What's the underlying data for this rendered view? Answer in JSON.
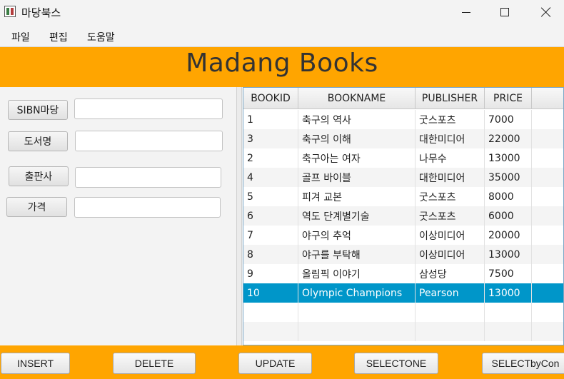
{
  "window": {
    "title": "마당북스"
  },
  "menu": {
    "items": [
      "파일",
      "편집",
      "도움말"
    ]
  },
  "header": {
    "title": "Madang Books",
    "background": "#ffa500"
  },
  "form": {
    "fields": [
      {
        "label": "SIBN마당",
        "value": ""
      },
      {
        "label": "도서명",
        "value": ""
      },
      {
        "label": "출판사",
        "value": ""
      },
      {
        "label": "가격",
        "value": ""
      }
    ]
  },
  "table": {
    "columns": [
      "BOOKID",
      "BOOKNAME",
      "PUBLISHER",
      "PRICE",
      ""
    ],
    "rows": [
      [
        "1",
        "축구의 역사",
        "굿스포츠",
        "7000"
      ],
      [
        "3",
        "축구의 이해",
        "대한미디어",
        "22000"
      ],
      [
        "2",
        "축구아는 여자",
        "나무수",
        "13000"
      ],
      [
        "4",
        "골프 바이블",
        "대한미디어",
        "35000"
      ],
      [
        "5",
        "피겨 교본",
        "굿스포츠",
        "8000"
      ],
      [
        "6",
        "역도 단계별기술",
        "굿스포츠",
        "6000"
      ],
      [
        "7",
        "야구의 추억",
        "이상미디어",
        "20000"
      ],
      [
        "8",
        "야구를 부탁해",
        "이상미디어",
        "13000"
      ],
      [
        "9",
        "올림픽 이야기",
        "삼성당",
        "7500"
      ],
      [
        "10",
        "Olympic Champions",
        "Pearson",
        "13000"
      ],
      [
        "",
        "",
        "",
        ""
      ],
      [
        "",
        "",
        "",
        ""
      ]
    ],
    "selected_row_index": 9,
    "selection_color": "#0096c9"
  },
  "actions": {
    "buttons": [
      "INSERT",
      "DELETE",
      "UPDATE",
      "SELECTONE",
      "SELECTbyCon"
    ]
  }
}
